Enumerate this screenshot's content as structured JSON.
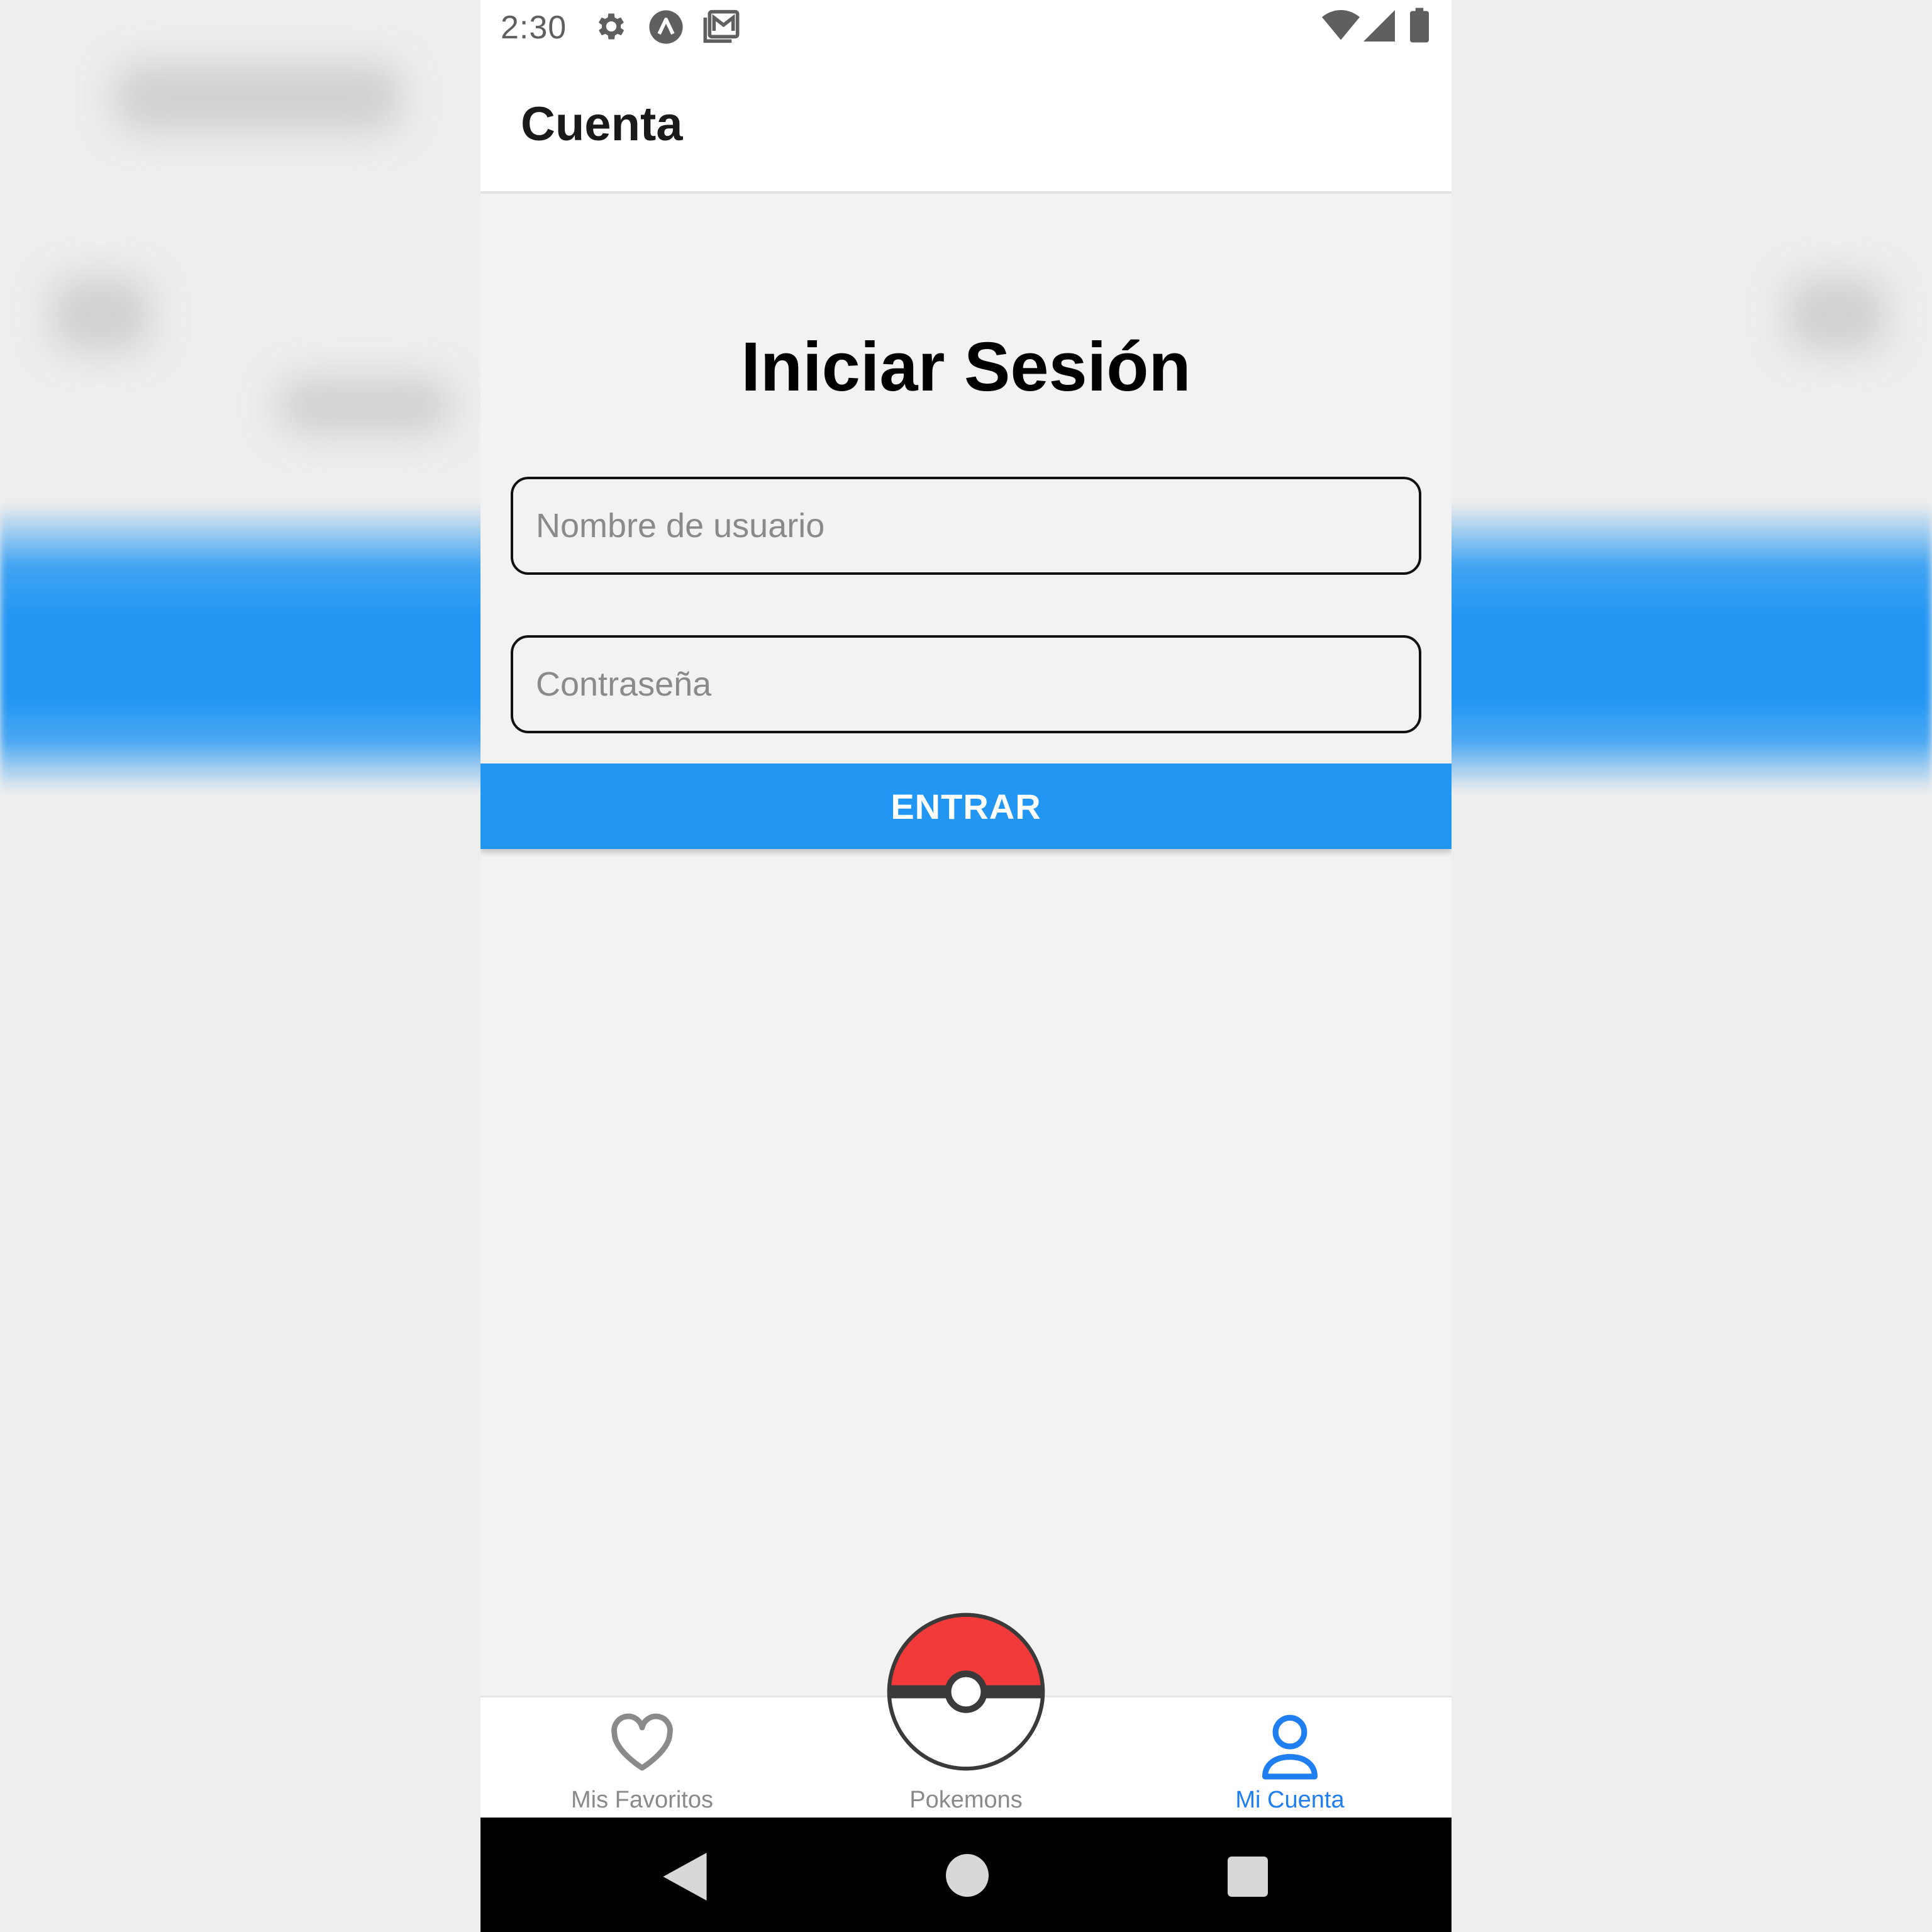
{
  "status_bar": {
    "time": "2:30",
    "icons": [
      "settings-icon",
      "app-notification-icon",
      "mail-icon",
      "wifi-icon",
      "signal-icon",
      "battery-icon"
    ]
  },
  "app_bar": {
    "title": "Cuenta"
  },
  "login": {
    "title": "Iniciar Sesión",
    "username_placeholder": "Nombre de usuario",
    "username_value": "",
    "password_placeholder": "Contraseña",
    "password_value": "",
    "submit_label": "ENTRAR"
  },
  "tabbar": {
    "tabs": [
      {
        "label": "Mis Favoritos",
        "icon": "heart-icon",
        "active": false
      },
      {
        "label": "Pokemons",
        "icon": "pokeball-icon",
        "active": false
      },
      {
        "label": "Mi Cuenta",
        "icon": "user-icon",
        "active": true
      }
    ]
  },
  "nav": {
    "buttons": [
      "back-icon",
      "home-icon",
      "recents-icon"
    ]
  },
  "colors": {
    "accent": "#2196f3",
    "active_tab": "#1f7ef0",
    "inactive_tab": "#8a8a8a",
    "pokeball_red": "#f23a3a"
  }
}
